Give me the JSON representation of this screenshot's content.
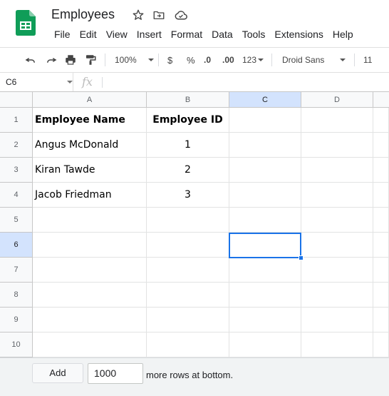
{
  "header": {
    "title": "Employees",
    "icons": [
      "spreadsheet-logo",
      "star-icon",
      "move-folder-icon",
      "cloud-saved-icon"
    ]
  },
  "menu": [
    "File",
    "Edit",
    "View",
    "Insert",
    "Format",
    "Data",
    "Tools",
    "Extensions",
    "Help"
  ],
  "toolbar": {
    "zoom": "100%",
    "currency": "$",
    "percent": "%",
    "decrease_decimal": ".0",
    "increase_decimal": ".00",
    "number_format": "123",
    "font": "Droid Sans",
    "font_size": "11",
    "icons": [
      "undo-icon",
      "redo-icon",
      "print-icon",
      "paint-format-icon"
    ]
  },
  "formula_bar": {
    "cell_ref": "C6",
    "fx": "fx",
    "value": ""
  },
  "columns": [
    "A",
    "B",
    "C",
    "D"
  ],
  "rows": [
    "1",
    "2",
    "3",
    "4",
    "5",
    "6",
    "7",
    "8",
    "9",
    "10"
  ],
  "cells": {
    "A1": "Employee Name",
    "B1": "Employee ID",
    "A2": "Angus McDonald",
    "B2": "1",
    "A3": "Kiran Tawde",
    "B3": "2",
    "A4": "Jacob Friedman",
    "B4": "3"
  },
  "selected_cell": "C6",
  "footer": {
    "add_label": "Add",
    "rows_value": "1000",
    "suffix": "more rows at bottom."
  },
  "colors": {
    "accent": "#1a73e8",
    "sheets_green": "#0f9d58",
    "header_bg": "#f8f9fa",
    "selected_header_bg": "#d3e3fd"
  }
}
